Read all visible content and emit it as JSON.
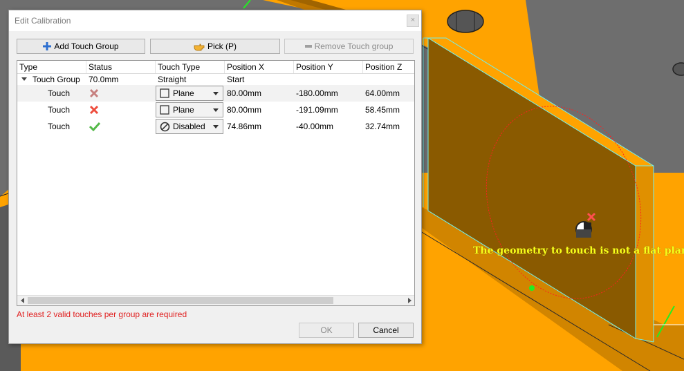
{
  "dialog": {
    "title": "Edit Calibration",
    "close_symbol": "×",
    "toolbar": {
      "add_touch_group": "Add Touch Group",
      "pick": "Pick (P)",
      "remove_touch_group": "Remove Touch group"
    },
    "columns": [
      "Type",
      "Status",
      "Touch Type",
      "Position X",
      "Position Y",
      "Position Z"
    ],
    "group_row": {
      "type": "Touch Group",
      "status": "70.0mm",
      "touch_type": "Straight",
      "position_x": "Start"
    },
    "rows": [
      {
        "type": "Touch",
        "status_icon": "x-mark-icon-muted",
        "touch_type": "Plane",
        "touch_type_icon": "square-icon",
        "x": "80.00mm",
        "y": "-180.00mm",
        "z": "64.00mm"
      },
      {
        "type": "Touch",
        "status_icon": "x-mark-icon",
        "touch_type": "Plane",
        "touch_type_icon": "square-icon",
        "x": "80.00mm",
        "y": "-191.09mm",
        "z": "58.45mm"
      },
      {
        "type": "Touch",
        "status_icon": "check-icon",
        "touch_type": "Disabled",
        "touch_type_icon": "prohibited-icon",
        "x": "74.86mm",
        "y": "-40.00mm",
        "z": "32.74mm"
      }
    ],
    "error_message": "At least 2 valid touches per group are required",
    "ok_label": "OK",
    "cancel_label": "Cancel"
  },
  "viewport": {
    "message": "The geometry to touch is not a flat plane"
  },
  "colors": {
    "part_orange": "#ffa300",
    "face_brown": "#8a5a00",
    "error_red": "#e02020",
    "message_yellow": "#f7ff1a",
    "valid_green": "#54b948"
  }
}
